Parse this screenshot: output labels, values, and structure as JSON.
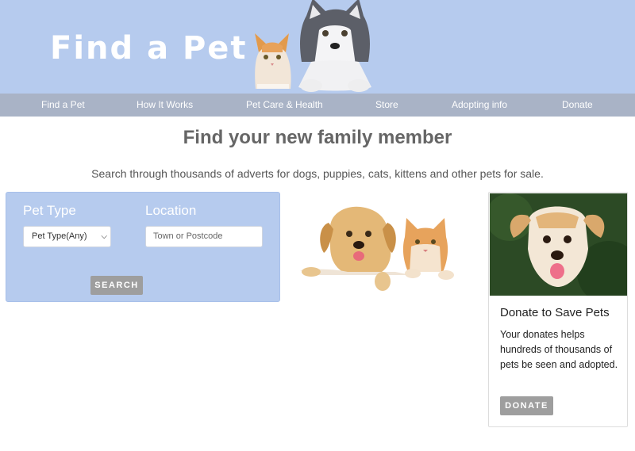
{
  "header": {
    "logo_text": "Find a Pet"
  },
  "nav": {
    "items": [
      {
        "label": "Find a Pet"
      },
      {
        "label": "How It Works"
      },
      {
        "label": "Pet Care & Health"
      },
      {
        "label": "Store"
      },
      {
        "label": "Adopting info"
      },
      {
        "label": "Donate"
      }
    ]
  },
  "main": {
    "headline": "Find your new family member",
    "subline": "Search through thousands of adverts for dogs, puppies, cats, kittens and other pets for sale."
  },
  "search": {
    "pet_type_label": "Pet Type",
    "location_label": "Location",
    "pet_type_selected": "Pet Type(Any)",
    "location_placeholder": "Town or Postcode",
    "search_button": "SEARCH"
  },
  "donate": {
    "title": "Donate to Save Pets",
    "text": "Your donates helps hundreds of thousands of pets be seen and adopted.",
    "button": "DONATE"
  },
  "colors": {
    "banner": "#b6cbee",
    "nav": "#a9b3c6",
    "button": "#9e9e9e"
  }
}
